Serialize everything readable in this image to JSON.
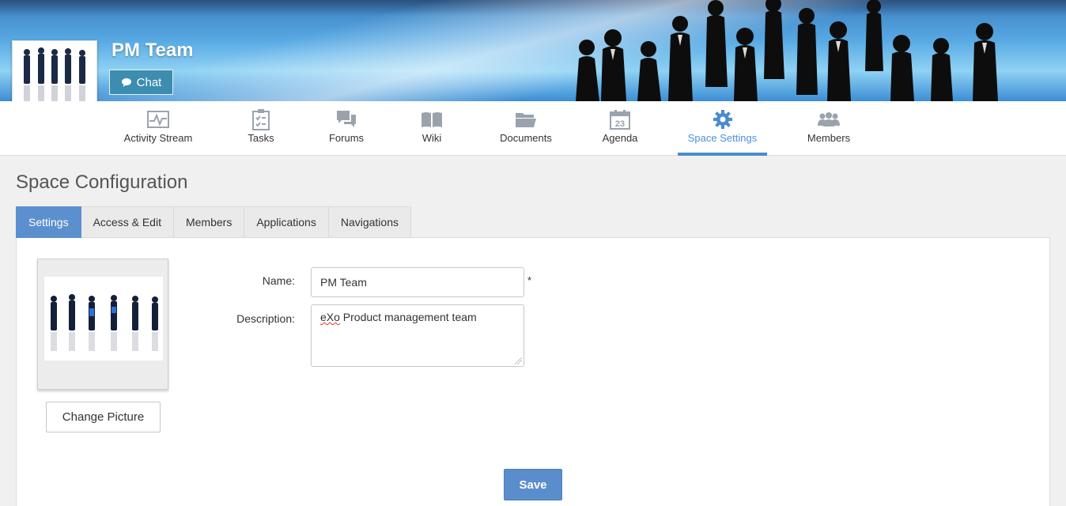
{
  "space": {
    "name": "PM Team",
    "chat_label": "Chat"
  },
  "nav": {
    "items": [
      {
        "label": "Activity Stream",
        "icon": "activity-stream-icon"
      },
      {
        "label": "Tasks",
        "icon": "tasks-icon"
      },
      {
        "label": "Forums",
        "icon": "forums-icon"
      },
      {
        "label": "Wiki",
        "icon": "wiki-icon"
      },
      {
        "label": "Documents",
        "icon": "documents-icon"
      },
      {
        "label": "Agenda",
        "icon": "agenda-icon",
        "icon_text": "23"
      },
      {
        "label": "Space Settings",
        "icon": "gear-icon",
        "active": true
      },
      {
        "label": "Members",
        "icon": "members-icon"
      }
    ]
  },
  "page": {
    "title": "Space Configuration"
  },
  "tabs": [
    {
      "label": "Settings",
      "active": true
    },
    {
      "label": "Access & Edit"
    },
    {
      "label": "Members"
    },
    {
      "label": "Applications"
    },
    {
      "label": "Navigations"
    }
  ],
  "form": {
    "change_picture_label": "Change Picture",
    "name_label": "Name:",
    "name_value": "PM Team",
    "required_mark": "*",
    "description_label": "Description:",
    "description_value_word1": "eXo",
    "description_value_rest": " Product management team",
    "save_label": "Save"
  },
  "colors": {
    "accent": "#4a8bd0",
    "chat_button": "#3c8db0",
    "active_tab": "#5c8fcd",
    "save_button": "#5a8dcb"
  }
}
